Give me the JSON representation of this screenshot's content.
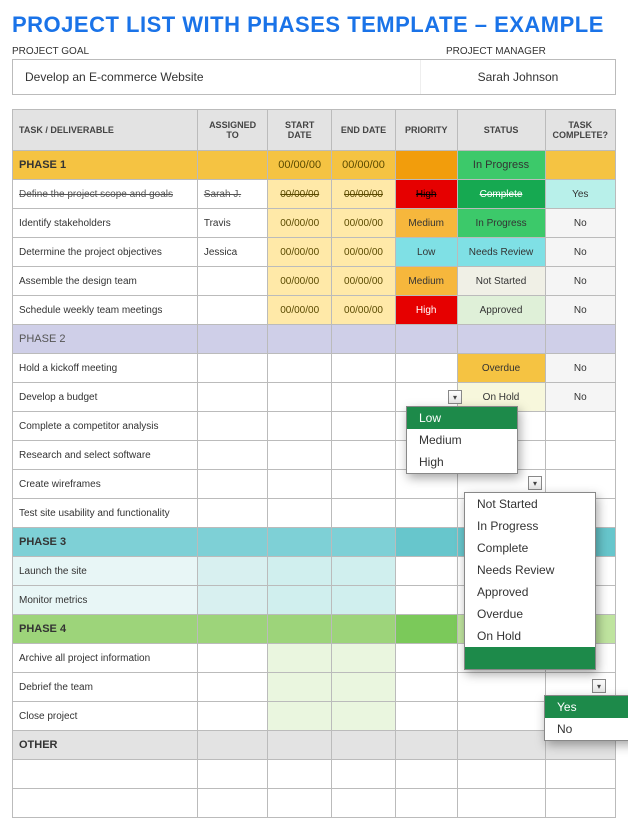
{
  "title": "PROJECT LIST WITH PHASES TEMPLATE – EXAMPLE",
  "labels": {
    "project_goal": "PROJECT GOAL",
    "project_manager": "PROJECT MANAGER"
  },
  "fields": {
    "project_goal": "Develop an E-commerce Website",
    "project_manager": "Sarah Johnson"
  },
  "columns": {
    "task": "TASK  / DELIVERABLE",
    "assigned": "ASSIGNED TO",
    "start": "START DATE",
    "end": "END DATE",
    "priority": "PRIORITY",
    "status": "STATUS",
    "complete": "TASK COMPLETE?"
  },
  "phase_labels": {
    "p1": "PHASE 1",
    "p2": "PHASE 2",
    "p3": "PHASE 3",
    "p4": "PHASE 4",
    "other": "OTHER"
  },
  "phase1_header": {
    "start": "00/00/00",
    "end": "00/00/00",
    "status": "In Progress"
  },
  "rows": {
    "p1": [
      {
        "task": "Define the project scope and goals",
        "assigned": "Sarah J.",
        "start": "00/00/00",
        "end": "00/00/00",
        "priority": "High",
        "status": "Complete",
        "complete": "Yes",
        "struck": true
      },
      {
        "task": "Identify stakeholders",
        "assigned": "Travis",
        "start": "00/00/00",
        "end": "00/00/00",
        "priority": "Medium",
        "status": "In Progress",
        "complete": "No"
      },
      {
        "task": "Determine the project objectives",
        "assigned": "Jessica",
        "start": "00/00/00",
        "end": "00/00/00",
        "priority": "Low",
        "status": "Needs Review",
        "complete": "No"
      },
      {
        "task": "Assemble the design team",
        "assigned": "",
        "start": "00/00/00",
        "end": "00/00/00",
        "priority": "Medium",
        "status": "Not Started",
        "complete": "No"
      },
      {
        "task": "Schedule weekly team meetings",
        "assigned": "",
        "start": "00/00/00",
        "end": "00/00/00",
        "priority": "High",
        "status": "Approved",
        "complete": "No"
      }
    ],
    "p2": [
      {
        "task": "Hold a kickoff meeting",
        "status": "Overdue",
        "complete": "No"
      },
      {
        "task": "Develop a budget",
        "status": "On Hold",
        "complete": "No"
      },
      {
        "task": "Complete a competitor analysis"
      },
      {
        "task": "Research and select software"
      },
      {
        "task": "Create wireframes"
      },
      {
        "task": "Test site usability and functionality"
      }
    ],
    "p3": [
      {
        "task": "Launch the site"
      },
      {
        "task": "Monitor metrics"
      }
    ],
    "p4": [
      {
        "task": "Archive all project information"
      },
      {
        "task": "Debrief the team"
      },
      {
        "task": "Close project"
      }
    ]
  },
  "dropdowns": {
    "priority": {
      "options": [
        "Low",
        "Medium",
        "High"
      ],
      "selected": "Low"
    },
    "status": {
      "options": [
        "Not Started",
        "In Progress",
        "Complete",
        "Needs Review",
        "Approved",
        "Overdue",
        "On Hold"
      ]
    },
    "complete": {
      "options": [
        "Yes",
        "No"
      ],
      "selected": "Yes"
    }
  }
}
